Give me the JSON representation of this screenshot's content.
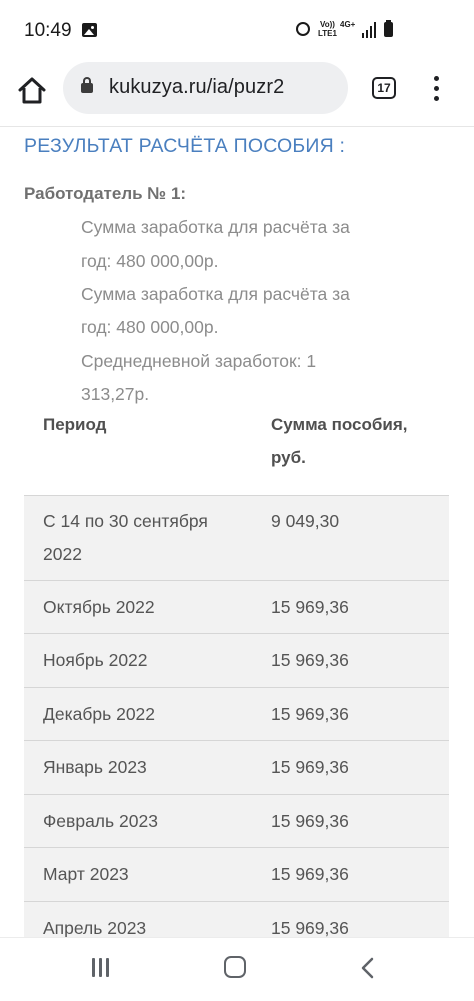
{
  "status_bar": {
    "time": "10:49",
    "volte_line1": "Vo))",
    "volte_line2": "LTE1",
    "network": "4G+",
    "icons": [
      "gallery-icon",
      "alarm-icon",
      "signal-icon",
      "battery-icon"
    ]
  },
  "browser": {
    "url": "kukuzya.ru/ia/puzr2",
    "tab_count": "17",
    "icons": [
      "home-icon",
      "lock-icon",
      "tabs-icon",
      "more-vert-icon"
    ]
  },
  "page": {
    "title": "РЕЗУЛЬТАТ РАСЧЁТА ПОСОБИЯ :",
    "employer_label": "Работодатель № 1:",
    "info_lines": [
      "Сумма заработка для расчёта за",
      "год: 480 000,00р.",
      "Сумма заработка для расчёта за",
      "год: 480 000,00р.",
      "Среднедневной заработок: 1",
      "313,27р."
    ],
    "table": {
      "header_period": "Период",
      "header_sum_line1": "Сумма пособия,",
      "header_sum_line2": "руб.",
      "rows": [
        {
          "period_line1": "С 14 по 30 сентября",
          "period_line2": "2022",
          "sum": "9 049,30"
        },
        {
          "period_line1": "Октябрь 2022",
          "sum": "15 969,36"
        },
        {
          "period_line1": "Ноябрь 2022",
          "sum": "15 969,36"
        },
        {
          "period_line1": "Декабрь 2022",
          "sum": "15 969,36"
        },
        {
          "period_line1": "Январь 2023",
          "sum": "15 969,36"
        },
        {
          "period_line1": "Февраль 2023",
          "sum": "15 969,36"
        },
        {
          "period_line1": "Март 2023",
          "sum": "15 969,36"
        },
        {
          "period_line1": "Апрель 2023",
          "sum": "15 969,36"
        }
      ]
    }
  },
  "colors": {
    "title_blue": "#4a7fbf",
    "row_background": "#f2f2f2",
    "url_box": "#eeeff1"
  },
  "nav_bar": {
    "icons": [
      "recent-apps-icon",
      "home-nav-icon",
      "back-icon"
    ]
  }
}
